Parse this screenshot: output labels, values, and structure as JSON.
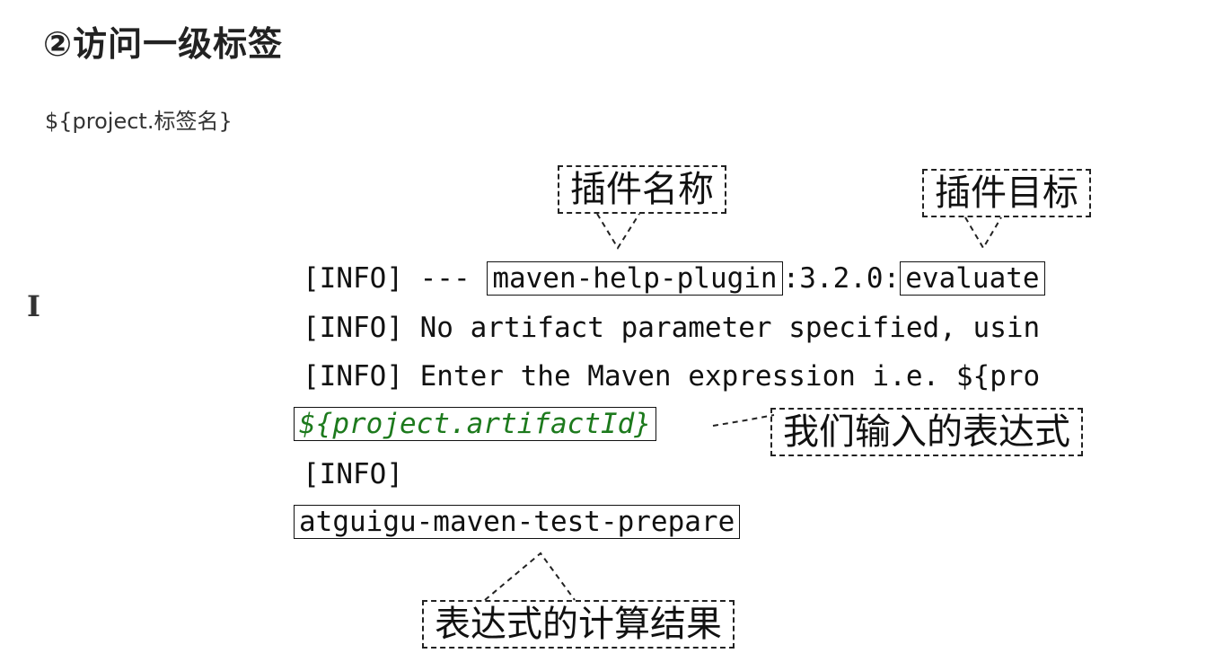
{
  "heading": "②访问一级标签",
  "syntax": "${project.标签名}",
  "callouts": {
    "plugin_name": "插件名称",
    "plugin_goal": "插件目标",
    "input_expression": "我们输入的表达式",
    "result": "表达式的计算结果"
  },
  "console": {
    "line1": {
      "prefix": "[INFO] --- ",
      "plugin": "maven-help-plugin",
      "version": ":3.2.0:",
      "goal": "evaluate"
    },
    "line2": "[INFO] No artifact parameter specified, usin",
    "line3": "[INFO] Enter the Maven expression i.e. ${pro",
    "line4_expression": "${project.artifactId}",
    "line5": "[INFO]",
    "line6_result": "atguigu-maven-test-prepare"
  }
}
